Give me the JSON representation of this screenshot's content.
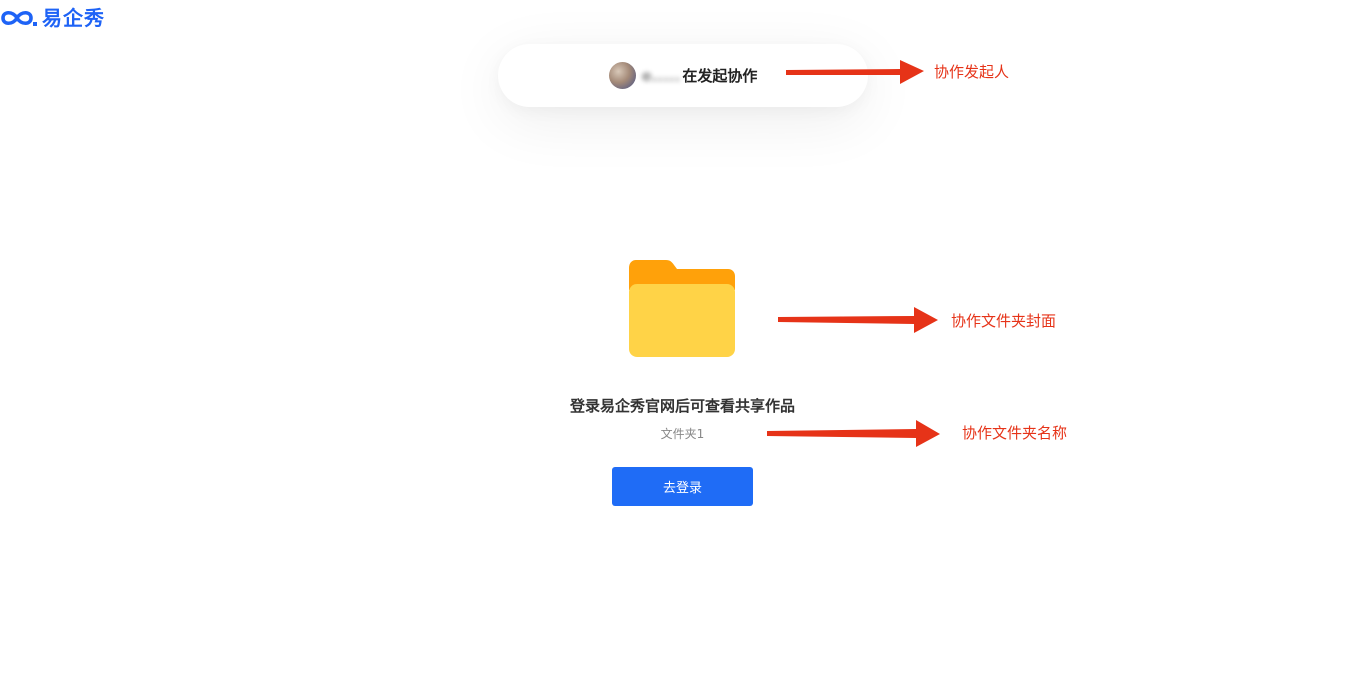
{
  "header": {
    "logo_text": "易企秀",
    "logo_icon": "infinity-logo-icon",
    "brand_color": "#1e63f6"
  },
  "initiator": {
    "blurred_name": "e.....",
    "suffix_text": "在发起协作",
    "avatar_icon": "avatar"
  },
  "main": {
    "folder_icon": "folder-icon",
    "share_title": "登录易企秀官网后可查看共享作品",
    "folder_name": "文件夹1",
    "login_button_label": "去登录",
    "button_color": "#1f6cf6"
  },
  "annotations": {
    "color": "#e63318",
    "initiator_label": "协作发起人",
    "cover_label": "协作文件夹封面",
    "name_label": "协作文件夹名称"
  }
}
